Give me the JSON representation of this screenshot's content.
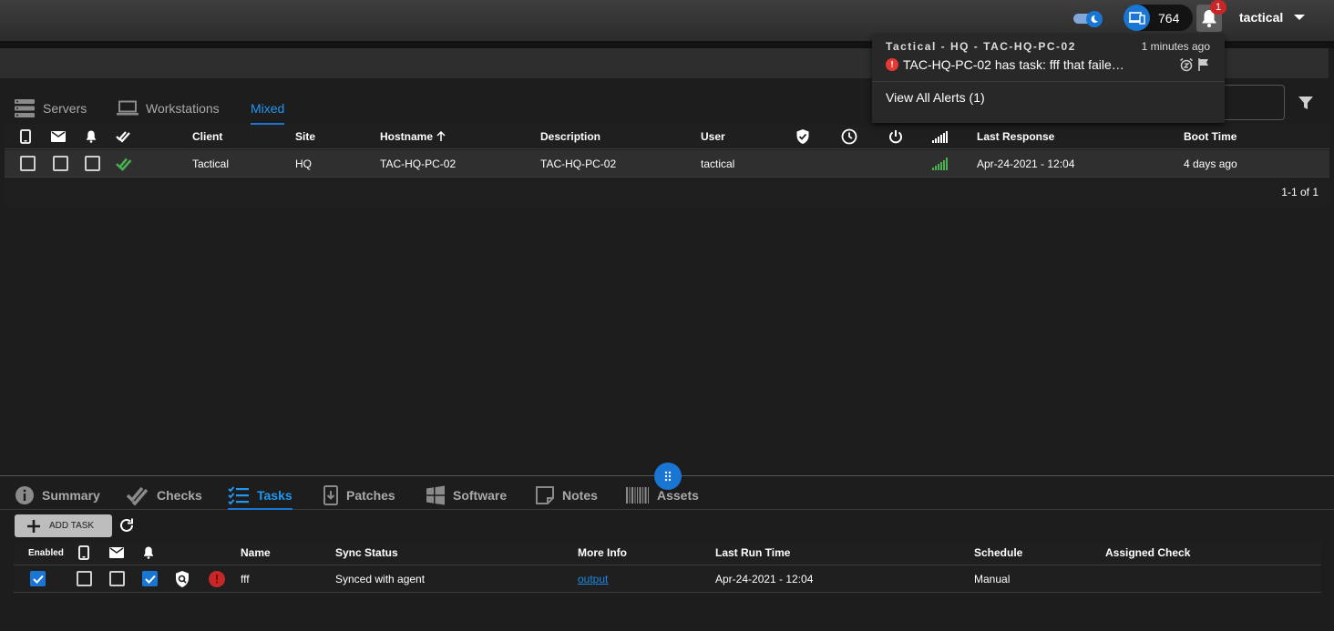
{
  "topbar": {
    "agent_count": "764",
    "notification_count": "1",
    "username": "tactical"
  },
  "alerts": {
    "items": [
      {
        "title": "Tactical - HQ - TAC-HQ-PC-02",
        "time": "1 minutes ago",
        "message": "TAC-HQ-PC-02 has task: fff that faile…",
        "severity_color": "#e53935"
      }
    ],
    "view_all": "View All Alerts (1)"
  },
  "agent_tabs": [
    {
      "label": "Servers",
      "icon": "server-icon"
    },
    {
      "label": "Workstations",
      "icon": "laptop-icon"
    },
    {
      "label": "Mixed",
      "icon": ""
    }
  ],
  "agent_table": {
    "columns": [
      "Client",
      "Site",
      "Hostname",
      "Description",
      "User",
      "Last Response",
      "Boot Time"
    ],
    "rows": [
      {
        "client": "Tactical",
        "site": "HQ",
        "hostname": "TAC-HQ-PC-02",
        "description": "TAC-HQ-PC-02",
        "user": "tactical",
        "last_response": "Apr-24-2021 - 12:04",
        "boot_time": "4 days ago"
      }
    ],
    "pagination": "1-1 of 1"
  },
  "bottom_tabs": [
    {
      "label": "Summary",
      "icon": "info-icon"
    },
    {
      "label": "Checks",
      "icon": "checks-icon"
    },
    {
      "label": "Tasks",
      "icon": "tasks-icon"
    },
    {
      "label": "Patches",
      "icon": "patches-icon"
    },
    {
      "label": "Software",
      "icon": "windows-icon"
    },
    {
      "label": "Notes",
      "icon": "note-icon"
    },
    {
      "label": "Assets",
      "icon": "barcode-icon"
    }
  ],
  "tasks": {
    "add_label": "ADD TASK",
    "columns": [
      "Enabled",
      "Name",
      "Sync Status",
      "More Info",
      "Last Run Time",
      "Schedule",
      "Assigned Check"
    ],
    "rows": [
      {
        "name": "fff",
        "sync_status": "Synced with agent",
        "more_info": "output",
        "last_run": "Apr-24-2021 - 12:04",
        "schedule": "Manual",
        "assigned_check": ""
      }
    ]
  },
  "colors": {
    "accent": "#1976d2",
    "success": "#4caf50",
    "error": "#c62828"
  }
}
